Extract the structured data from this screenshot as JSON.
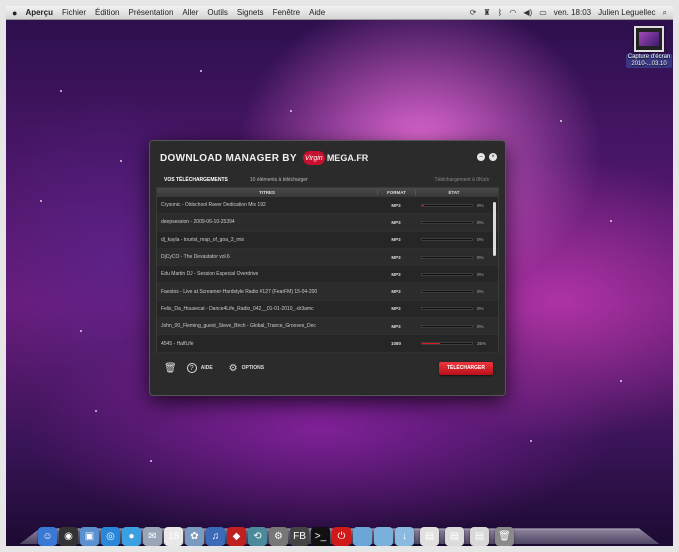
{
  "menubar": {
    "apple": "",
    "items": [
      "Aperçu",
      "Fichier",
      "Édition",
      "Présentation",
      "Aller",
      "Outils",
      "Signets",
      "Fenêtre",
      "Aide"
    ],
    "clock": "ven. 18:03",
    "user": "Julien Leguellec"
  },
  "desktop": {
    "file_label_1": "Capture d'écran",
    "file_label_2": "2010-...03.10"
  },
  "window": {
    "title": "DOWNLOAD MANAGER BY",
    "brand_logo": "Virgin",
    "brand_a": "",
    "brand_b": "MEGA.FR",
    "tab_active": "VOS TÉLÉCHARGEMENTS",
    "tab_count": "10 éléments à télécharger",
    "tab_right": "Téléchargement à 0Ko/s",
    "columns": {
      "title": "TITRES",
      "format": "FORMAT",
      "state": "ÉTAT"
    },
    "rows": [
      {
        "title": "Crysonic - Oldschool Raver Dedication Mix 192",
        "format": "MP3",
        "progress": 0.04,
        "pct": "0%"
      },
      {
        "title": "deepsession - 2009-06-10-25394",
        "format": "MP3",
        "progress": 0,
        "pct": "0%"
      },
      {
        "title": "dj_kayla - tourist_map_of_goa_3_mix",
        "format": "MP3",
        "progress": 0,
        "pct": "0%"
      },
      {
        "title": "DjCyCO - The Devastator vol.6",
        "format": "MP3",
        "progress": 0,
        "pct": "0%"
      },
      {
        "title": "Edu Martin DJ - Session Especial Overdrive",
        "format": "MP3",
        "progress": 0,
        "pct": "0%"
      },
      {
        "title": "Faestos - Live at Screamer-Hardstyle Radio #127 (FearFM) 15-04-200",
        "format": "MP3",
        "progress": 0,
        "pct": "0%"
      },
      {
        "title": "Felix_Da_Housecat - Dance4Life_Radio_042__01-01-2010_-dr3amc",
        "format": "MP3",
        "progress": 0,
        "pct": "0%"
      },
      {
        "title": "John_00_Fleming_guest_Steve_Birch - Global_Trance_Grooves_Dec",
        "format": "MP3",
        "progress": 0,
        "pct": "0%"
      },
      {
        "title": "4545 - HalfLife",
        "format": "1080",
        "progress": 0.35,
        "pct": "35%"
      }
    ],
    "footer": {
      "help_label": "AIDE",
      "options_label": "OPTIONS",
      "download_label": "TÉLÉCHARGER"
    }
  },
  "dock": {
    "items": [
      {
        "name": "finder-icon",
        "glyph": "☺",
        "color": "#3a78d6"
      },
      {
        "name": "dashboard-icon",
        "glyph": "◉",
        "color": "#333"
      },
      {
        "name": "preview-icon",
        "glyph": "▣",
        "color": "#5a8fd0"
      },
      {
        "name": "safari-icon",
        "glyph": "◎",
        "color": "#2a86d8"
      },
      {
        "name": "ichat-icon",
        "glyph": "●",
        "color": "#3aa0e0"
      },
      {
        "name": "mail-icon",
        "glyph": "✉",
        "color": "#9aa6b8"
      },
      {
        "name": "ical-icon",
        "glyph": "18",
        "color": "#e8e8e8"
      },
      {
        "name": "iphoto-icon",
        "glyph": "✿",
        "color": "#7a9ac0"
      },
      {
        "name": "itunes-icon",
        "glyph": "♫",
        "color": "#3a6ab8"
      },
      {
        "name": "photobooth-icon",
        "glyph": "◆",
        "color": "#c02020"
      },
      {
        "name": "timemachine-icon",
        "glyph": "⟲",
        "color": "#4a8a9a"
      },
      {
        "name": "system-preferences-icon",
        "glyph": "⚙",
        "color": "#777"
      },
      {
        "name": "filebrowser-icon",
        "glyph": "FB",
        "color": "#444"
      },
      {
        "name": "terminal-icon",
        "glyph": ">_",
        "color": "#111"
      },
      {
        "name": "app-red-icon",
        "glyph": "⏻",
        "color": "#d01a1a"
      },
      {
        "name": "folder-applications-icon",
        "glyph": "",
        "color": "#6aa6d8"
      },
      {
        "name": "folder-documents-icon",
        "glyph": "",
        "color": "#7ab0dc"
      },
      {
        "name": "folder-downloads-icon",
        "glyph": "↓",
        "color": "#8abae0"
      },
      {
        "name": "stack-1-icon",
        "glyph": "▤",
        "color": "#e0e0e0"
      },
      {
        "name": "stack-2-icon",
        "glyph": "▤",
        "color": "#dcdcdc"
      },
      {
        "name": "stack-3-icon",
        "glyph": "▤",
        "color": "#d8d8d8"
      },
      {
        "name": "trash-icon",
        "glyph": "🗑",
        "color": "#8a8a8a"
      }
    ]
  },
  "colors": {
    "accent": "#d8161f",
    "window_bg": "#2b2b2b"
  }
}
